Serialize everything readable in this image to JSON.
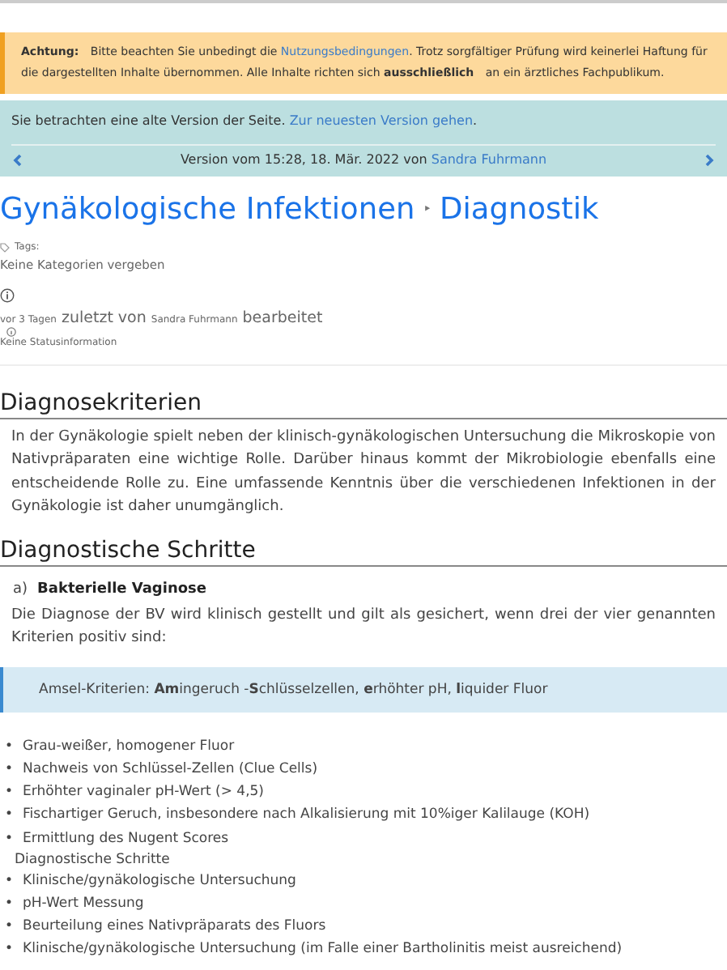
{
  "notice": {
    "label": "Achtung:",
    "text_before": "Bitte beachten Sie unbedingt die",
    "link": "Nutzungsbedingungen",
    "text_after": ". Trotz sorgfältiger Prüfung wird keinerlei Haftung für die dargestellten Inhalte übernommen. Alle Inhalte richten sich **ausschließlich** an ein ärztliches Fachpublikum."
  },
  "version_bar": {
    "message": "Sie betrachten eine alte Version der Seite.",
    "link": "Zur neuesten Version gehen",
    "link_end": ".",
    "version_text": "Version vom 15:28, 18. Mär. 2022 von",
    "author": "Sandra Fuhrmann"
  },
  "title": {
    "parent": "Gynäkologische Infektionen",
    "separator": "‣",
    "page": "Diagnostik"
  },
  "meta": {
    "tags_label": "Tags:",
    "categories": "Keine Kategorien vergeben",
    "edited_when": "vor 3 Tagen",
    "edited_by_label": "zuletzt von",
    "editor": "Sandra Fuhrmann",
    "edited_label": "bearbeitet",
    "status": "Keine Statusinformation"
  },
  "sections": [
    {
      "heading": "Diagnosekriterien",
      "blocks": [
        {
          "kind": "paragraph",
          "text": "In der Gynäkologie spielt neben der klinisch-gynäkologischen Untersuchung die Mikroskopie von Nativpräparaten eine wichtige Rolle. Darüber hinaus kommt der Mikrobiologie ebenfalls eine entscheidende Rolle zu. Eine umfassende Kenntnis über die verschiedenen Infektionen in der Gynäkologie ist daher unumgänglich."
        }
      ]
    },
    {
      "heading": "Diagnostische Schritte",
      "blocks": [
        {
          "kind": "subheading",
          "marker": "a)",
          "text": "Bakterielle Vaginose"
        },
        {
          "kind": "paragraph",
          "text": "Die Diagnose der BV wird klinisch gestellt und gilt als gesichert, wenn drei der vier genannten Kriterien positiv sind:"
        },
        {
          "kind": "callout",
          "text": "Amsel-Kriterien: **Am**ingeruch -**S**chlüsselzellen, **e**rhöhter pH, **l**iquider Fluor"
        },
        {
          "kind": "list",
          "marker": "•",
          "items": [
            "Grau-weißer, homogener Fluor",
            "Nachweis von Schlüssel-Zellen (Clue Cells)",
            "Erhöhter vaginaler pH-Wert (> 4,5)",
            "Fischartiger Geruch, insbesondere nach Alkalisierung mit 10%iger Kalilauge (KOH)",
            "Ermittlung des Nugent Scores"
          ]
        },
        {
          "kind": "label",
          "text": "Diagnostische Schritte"
        },
        {
          "kind": "list",
          "marker": "•",
          "items": [
            "Klinische/gynäkologische Untersuchung",
            "pH-Wert Messung",
            "Beurteilung eines Nativpräparats des Fluors",
            "Klinische/gynäkologische Untersuchung (im Falle einer Bartholinitis meist ausreichend)"
          ]
        }
      ]
    }
  ]
}
